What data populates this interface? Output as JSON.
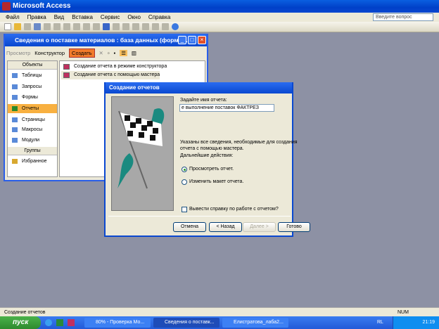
{
  "app": {
    "title": "Microsoft Access",
    "ask_placeholder": "Введите вопрос"
  },
  "menu": [
    "Файл",
    "Правка",
    "Вид",
    "Вставка",
    "Сервис",
    "Окно",
    "Справка"
  ],
  "db_window": {
    "title": "Сведения о поставке материалов : база данных (формат...",
    "toolbar": {
      "preview": "Просмотр",
      "design": "Конструктор",
      "create": "Создать"
    },
    "objects_header": "Объекты",
    "objects": [
      "Таблицы",
      "Запросы",
      "Формы",
      "Отчеты",
      "Страницы",
      "Макросы",
      "Модули"
    ],
    "selected": "Отчеты",
    "groups_header": "Группы",
    "groups": [
      "Избранное"
    ],
    "list": [
      "Создание отчета в режиме конструктора",
      "Создание отчета с помощью мастера"
    ]
  },
  "dialog": {
    "title": "Создание отчетов",
    "name_label": "Задайте имя отчета:",
    "name_value": "е выполнение поставок ФАКТРЕЗ",
    "info1": "Указаны все сведения, необходимые для создания",
    "info2": "отчета с помощью мастера.",
    "actions_label": "Дальнейшие действия:",
    "option_preview": "Просмотреть отчет.",
    "option_modify": "Изменить макет отчета.",
    "help_checkbox": "Вывести справку по работе с отчетом?",
    "buttons": {
      "cancel": "Отмена",
      "back": "< Назад",
      "next": "Далее >",
      "finish": "Готово"
    }
  },
  "status": {
    "text": "Создание отчетов",
    "num": "NUM"
  },
  "taskbar": {
    "start": "пуск",
    "tasks": [
      "80% - Проверка Мо...",
      "Сведения о поставк...",
      "Елистратова_лаба2..."
    ],
    "lang": "RL",
    "clock": "21:19"
  }
}
